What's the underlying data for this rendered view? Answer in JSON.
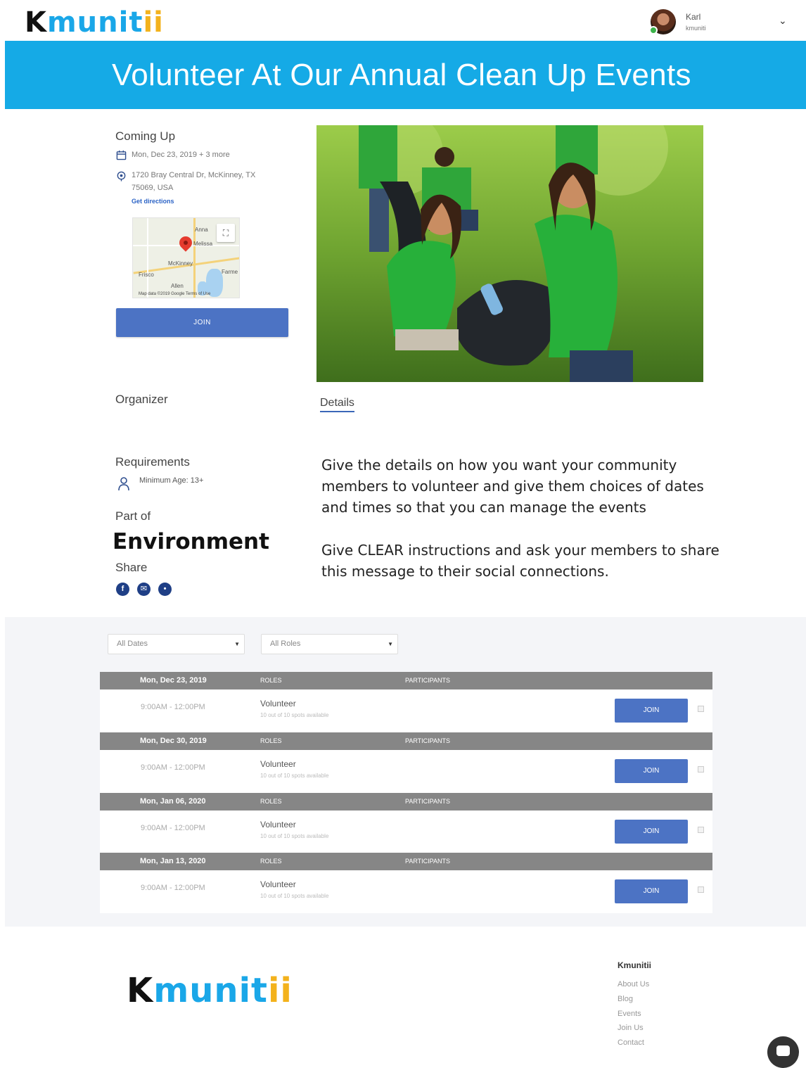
{
  "header": {
    "logo": {
      "k": "K",
      "mid": "munit",
      "end": "ii"
    },
    "user": {
      "name": "Karl",
      "org": "kmuniti"
    }
  },
  "banner": {
    "title": "Volunteer At Our Annual Clean Up Events"
  },
  "event": {
    "coming_up_label": "Coming Up",
    "date": "Mon, Dec 23, 2019 + 3 more",
    "address_line1": "1720 Bray Central Dr, McKinney, TX",
    "address_line2": "75069, USA",
    "directions": "Get directions",
    "map_labels": {
      "anna": "Anna",
      "melissa": "Melissa",
      "mckinney": "McKinney",
      "frisco": "Frisco",
      "farmersville": "Farme",
      "allen": "Allen",
      "footer": "Map data ©2019 Google   Terms of Use",
      "google": "Google"
    },
    "join_label": "JOIN",
    "organizer_label": "Organizer",
    "requirements_label": "Requirements",
    "min_age": "Minimum Age: 13+",
    "part_of_label": "Part of",
    "part_of_value": "Environment",
    "share_label": "Share"
  },
  "details": {
    "tab_label": "Details",
    "paragraph1": "Give the details on how you want your community members to volunteer and give them choices of dates and times so that you can manage the events",
    "paragraph2": "Give CLEAR instructions and ask your members to share this message to their social connections."
  },
  "filters": {
    "dates": "All Dates",
    "roles": "All Roles"
  },
  "schedule": {
    "roles_header": "ROLES",
    "participants_header": "PARTICIPANTS",
    "groups": [
      {
        "date": "Mon, Dec 23, 2019",
        "time": "9:00AM - 12:00PM",
        "role": "Volunteer",
        "spots": "10 out of 10 spots available",
        "join": "JOIN"
      },
      {
        "date": "Mon, Dec 30, 2019",
        "time": "9:00AM - 12:00PM",
        "role": "Volunteer",
        "spots": "10 out of 10 spots available",
        "join": "JOIN"
      },
      {
        "date": "Mon, Jan 06, 2020",
        "time": "9:00AM - 12:00PM",
        "role": "Volunteer",
        "spots": "10 out of 10 spots available",
        "join": "JOIN"
      },
      {
        "date": "Mon, Jan 13, 2020",
        "time": "9:00AM - 12:00PM",
        "role": "Volunteer",
        "spots": "10 out of 10 spots available",
        "join": "JOIN"
      }
    ]
  },
  "footer": {
    "column_title": "Kmunitii",
    "links": [
      "About Us",
      "Blog",
      "Events",
      "Join Us",
      "Contact"
    ]
  },
  "colors": {
    "banner": "#15aae6",
    "button": "#4c73c4",
    "logo_blue": "#1aa7e8",
    "logo_yellow": "#f3b21c"
  }
}
